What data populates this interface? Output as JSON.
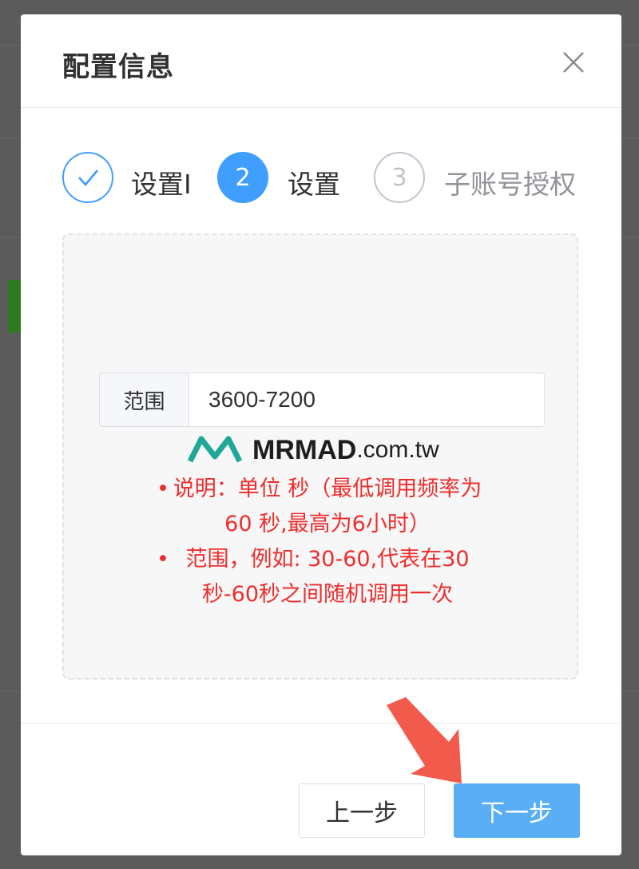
{
  "dialog": {
    "title": "配置信息"
  },
  "steps": [
    {
      "number": "1",
      "label": "设置I",
      "status": "done"
    },
    {
      "number": "2",
      "label": "设置",
      "status": "active"
    },
    {
      "number": "3",
      "label": "子账号授权",
      "status": "wait"
    }
  ],
  "form": {
    "range_label": "范围",
    "range_value": "3600-7200"
  },
  "watermark": {
    "brand": "MRMAD",
    "domain": ".com.tw"
  },
  "notes": [
    {
      "bullet": "•",
      "text": "说明：单位 秒（最低调用频率为 60 秒,最高为6小时）"
    },
    {
      "bullet": "•",
      "text": "范围，例如: 30-60,代表在30秒-60秒之间随机调用一次"
    }
  ],
  "footer": {
    "prev_label": "上一步",
    "next_label": "下一步"
  },
  "colors": {
    "primary": "#409eff",
    "next_button": "#5aaef6",
    "note_text": "#ee2d2d",
    "arrow": "#f25a4c"
  },
  "icons": {
    "close": "close-icon",
    "step_done": "check-icon",
    "annotation": "pointer-arrow-icon"
  }
}
